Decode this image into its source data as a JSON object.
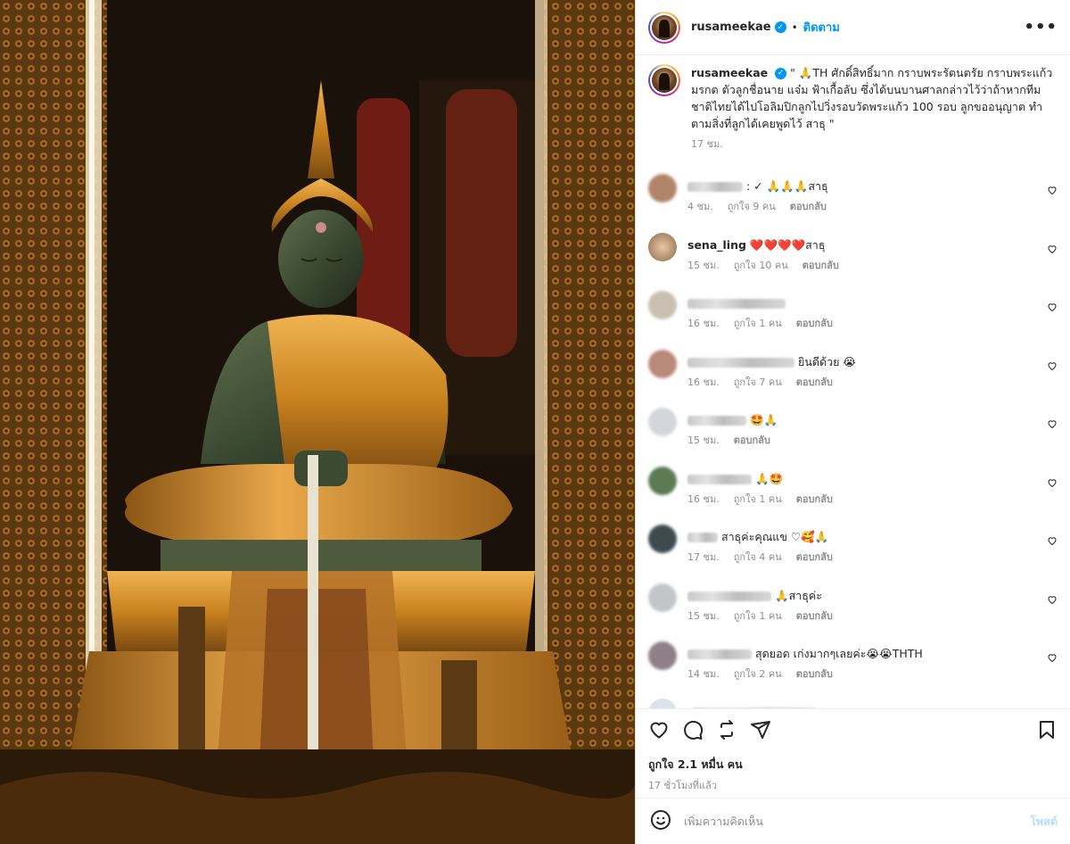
{
  "post": {
    "username": "rusameekae",
    "follow_label": "ติดตาม",
    "more_label": "•••",
    "caption": "\" 🙏TH ศักดิ์สิทธิ์มาก กราบพระรัตนตรัย กราบพระแก้วมรกต ตัวลูกชื่อนาย แจ๋ม ฟ้าเกื้อลับ ซึ่งได้บนบานศาลกล่าวไว้ว่าถ้าหากทีมชาติไทยได้ไปโอลิมปิกลูกไปวิ่งรอบวัดพระแก้ว 100 รอบ ลูกขออนุญาต ทำตามสิ่งที่ลูกได้เคยพูดไว้ สาธุ \"",
    "caption_time": "17 ชม.",
    "verified_mark": "✓"
  },
  "comments": [
    {
      "name": "",
      "text": ": ✓ 🙏🙏🙏สาธุ",
      "time": "4 ชม.",
      "likes": "ถูกใจ 9 คน",
      "reply": "ตอบกลับ",
      "avatar_color": "#b0856a"
    },
    {
      "name": "sena_ling",
      "text": "❤️❤️❤️❤️สาธุ",
      "time": "15 ชม.",
      "likes": "ถูกใจ 10 คน",
      "reply": "ตอบกลับ",
      "avatar_color": "#a98d6d"
    },
    {
      "name": "",
      "text": "",
      "time": "16 ชม.",
      "likes": "ถูกใจ 1 คน",
      "reply": "ตอบกลับ",
      "avatar_color": "#c9bfb2"
    },
    {
      "name": "",
      "text": "ยินดีด้วย 😭",
      "time": "16 ชม.",
      "likes": "ถูกใจ 7 คน",
      "reply": "ตอบกลับ",
      "avatar_color": "#b88a7a"
    },
    {
      "name": "",
      "text": "🤩🙏",
      "time": "15 ชม.",
      "likes": "",
      "reply": "ตอบกลับ",
      "avatar_color": "#d3d6da"
    },
    {
      "name": "",
      "text": "🙏🤩",
      "time": "16 ชม.",
      "likes": "ถูกใจ 1 คน",
      "reply": "ตอบกลับ",
      "avatar_color": "#5c7a54"
    },
    {
      "name": "",
      "text": "สาธุค่ะคุณแข ♡🥰🙏",
      "time": "17 ชม.",
      "likes": "ถูกใจ 4 คน",
      "reply": "ตอบกลับ",
      "avatar_color": "#3e4a4e"
    },
    {
      "name": "",
      "text": "🙏สาธุค่ะ",
      "time": "15 ชม.",
      "likes": "ถูกใจ 1 คน",
      "reply": "ตอบกลับ",
      "avatar_color": "#c2c6c9"
    },
    {
      "name": "",
      "text": "สุดยอด เก่งมากๆเลยค่ะ😭😭THTH",
      "time": "14 ชม.",
      "likes": "ถูกใจ 2 คน",
      "reply": "ตอบกลับ",
      "avatar_color": "#8f8088"
    }
  ],
  "footer": {
    "likes_label": "ถูกใจ 2.1 หมื่น คน",
    "time_label": "17 ชั่วโมงที่แล้ว",
    "comment_placeholder": "เพิ่มความคิดเห็น",
    "post_button": "โพสต์"
  }
}
